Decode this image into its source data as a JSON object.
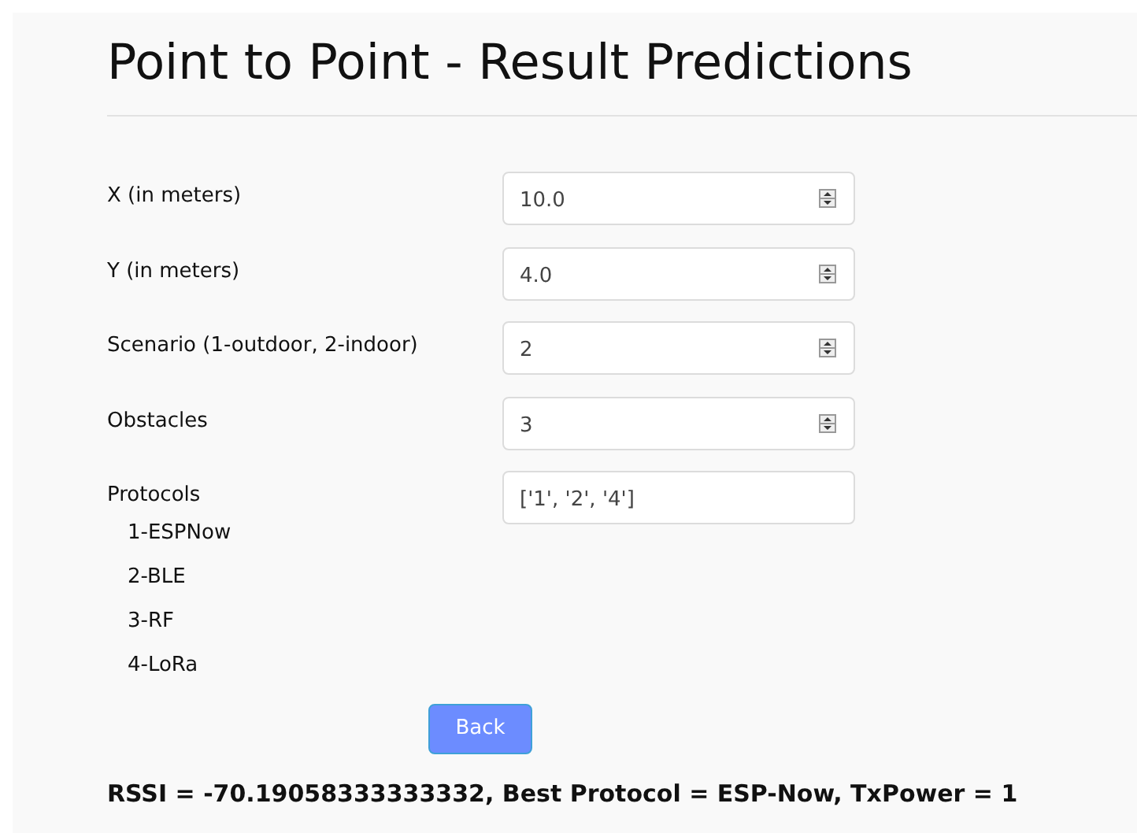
{
  "title": "Point to Point - Result Predictions",
  "fields": [
    {
      "label": "X (in meters)",
      "kind": "number",
      "value": "10.0"
    },
    {
      "label": "Y (in meters)",
      "kind": "number",
      "value": "4.0"
    },
    {
      "label": "Scenario (1-outdoor, 2-indoor)",
      "kind": "number",
      "value": "2"
    },
    {
      "label": "Obstacles",
      "kind": "number",
      "value": "3"
    },
    {
      "label": "Protocols",
      "kind": "text",
      "value": "['1', '2', '4']"
    }
  ],
  "protocol_options": [
    "1-ESPNow",
    "2-BLE",
    "3-RF",
    "4-LoRa"
  ],
  "button": "Back",
  "result": "RSSI = -70.19058333333332, Best Protocol = ESP-Now, TxPower = 1"
}
